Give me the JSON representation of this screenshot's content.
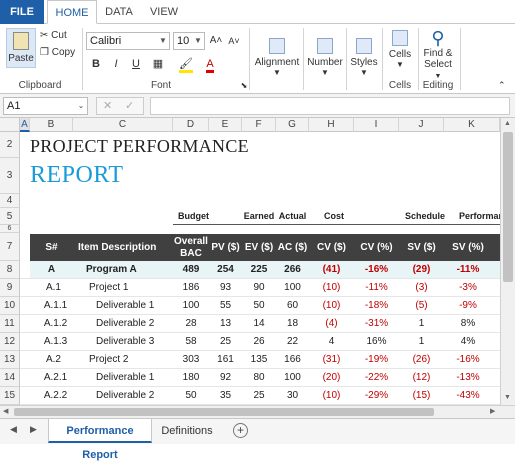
{
  "ribbon_tabs": [
    "FILE",
    "HOME",
    "DATA",
    "VIEW"
  ],
  "clipboard": {
    "paste": "Paste",
    "cut": "Cut",
    "copy": "Copy",
    "label": "Clipboard"
  },
  "font": {
    "name": "Calibri",
    "size": "10",
    "bold": "B",
    "italic": "I",
    "underline": "U",
    "label": "Font",
    "grow": "A˄",
    "shrink": "A˅"
  },
  "groups": {
    "alignment": "Alignment",
    "number": "Number",
    "styles": "Styles",
    "cells": "Cells",
    "cells_label": "Cells",
    "find_select": "Find &",
    "find_select2": "Select",
    "editing_label": "Editing"
  },
  "formula_bar": {
    "name_box": "A1",
    "cancel": "✕",
    "enter": "✓"
  },
  "col_headers": [
    "A",
    "B",
    "C",
    "D",
    "E",
    "F",
    "G",
    "H",
    "I",
    "J",
    "K"
  ],
  "row_numbers": [
    "2",
    "3",
    "4",
    "5",
    "6",
    "7",
    "8",
    "9",
    "10",
    "11",
    "12",
    "13",
    "14",
    "15"
  ],
  "title_line1": "PROJECT PERFORMANCE",
  "title_line2": "REPORT",
  "section_headers": {
    "budget": "Budget",
    "earned": "Earned",
    "actual": "Actual",
    "cost": "Cost",
    "schedule": "Schedule",
    "performance": "Performan"
  },
  "table_headers": [
    "S#",
    "Item Description",
    "Overall BAC ($)",
    "PV ($)",
    "EV ($)",
    "AC ($)",
    "CV ($)",
    "CV (%)",
    "SV ($)",
    "SV (%)"
  ],
  "rows": [
    {
      "sn": "A",
      "desc": "Program A",
      "bac": "489",
      "pv": "254",
      "ev": "225",
      "ac": "266",
      "cv": "(41)",
      "cvp": "-16%",
      "sv": "(29)",
      "svp": "-11%"
    },
    {
      "sn": "A.1",
      "desc": "Project 1",
      "bac": "186",
      "pv": "93",
      "ev": "90",
      "ac": "100",
      "cv": "(10)",
      "cvp": "-11%",
      "sv": "(3)",
      "svp": "-3%"
    },
    {
      "sn": "A.1.1",
      "desc": "Deliverable 1",
      "bac": "100",
      "pv": "55",
      "ev": "50",
      "ac": "60",
      "cv": "(10)",
      "cvp": "-18%",
      "sv": "(5)",
      "svp": "-9%"
    },
    {
      "sn": "A.1.2",
      "desc": "Deliverable 2",
      "bac": "28",
      "pv": "13",
      "ev": "14",
      "ac": "18",
      "cv": "(4)",
      "cvp": "-31%",
      "sv": "1",
      "svp": "8%"
    },
    {
      "sn": "A.1.3",
      "desc": "Deliverable 3",
      "bac": "58",
      "pv": "25",
      "ev": "26",
      "ac": "22",
      "cv": "4",
      "cvp": "16%",
      "sv": "1",
      "svp": "4%"
    },
    {
      "sn": "A.2",
      "desc": "Project 2",
      "bac": "303",
      "pv": "161",
      "ev": "135",
      "ac": "166",
      "cv": "(31)",
      "cvp": "-19%",
      "sv": "(26)",
      "svp": "-16%"
    },
    {
      "sn": "A.2.1",
      "desc": "Deliverable 1",
      "bac": "180",
      "pv": "92",
      "ev": "80",
      "ac": "100",
      "cv": "(20)",
      "cvp": "-22%",
      "sv": "(12)",
      "svp": "-13%"
    },
    {
      "sn": "A.2.2",
      "desc": "Deliverable 2",
      "bac": "50",
      "pv": "35",
      "ev": "25",
      "ac": "30",
      "cv": "(10)",
      "cvp": "-29%",
      "sv": "(15)",
      "svp": "-43%"
    }
  ],
  "sheet_tabs": {
    "active": "Performance Report",
    "other": "Definitions",
    "add": "+"
  },
  "colors": {
    "accent": "#1e5fa8",
    "title_blue": "#1a9bd7",
    "header_bg": "#404040",
    "negative": "#c00000",
    "row_highlight": "#e8f4f6"
  }
}
